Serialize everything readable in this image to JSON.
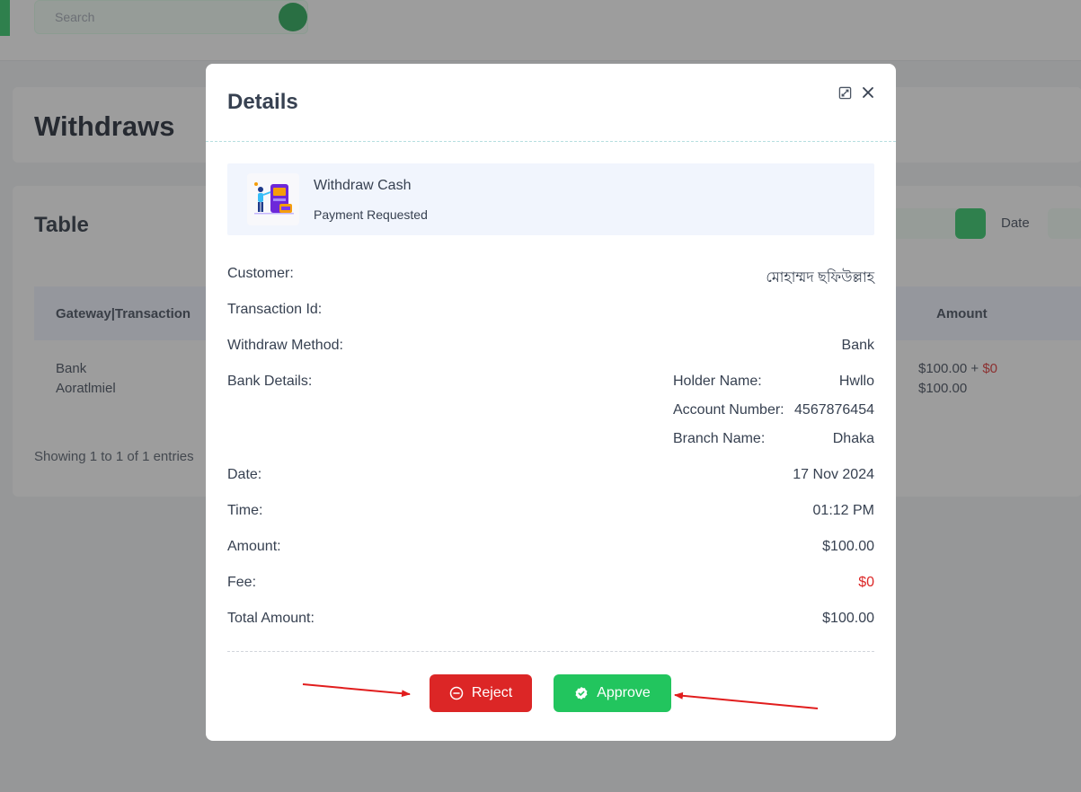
{
  "background": {
    "search_placeholder": "Search",
    "page_title": "Withdraws",
    "table_title": "Table",
    "date_label": "Date",
    "column_headers": [
      "Gateway|Transaction",
      "Amount"
    ],
    "row": {
      "gateway": "Bank",
      "transaction": "Aoratlmiel",
      "amount": "$100.00",
      "fee": "$0",
      "total": "$100.00"
    },
    "showing": "Showing 1 to 1 of 1 entries"
  },
  "modal": {
    "title": "Details",
    "summary": {
      "title": "Withdraw Cash",
      "subtitle": "Payment Requested"
    },
    "fields": {
      "customer_label": "Customer:",
      "customer_value": "মোহাম্মদ ছফিউল্লাহ",
      "transaction_label": "Transaction Id:",
      "transaction_value": "",
      "method_label": "Withdraw Method:",
      "method_value": "Bank",
      "bank_label": "Bank Details:",
      "holder_label": "Holder Name:",
      "holder_value": "Hwllo",
      "account_label": "Account Number:",
      "account_value": "4567876454",
      "branch_label": "Branch Name:",
      "branch_value": "Dhaka",
      "date_label": "Date:",
      "date_value": "17 Nov 2024",
      "time_label": "Time:",
      "time_value": "01:12 PM",
      "amount_label": "Amount:",
      "amount_value": "$100.00",
      "fee_label": "Fee:",
      "fee_value": "$0",
      "total_label": "Total Amount:",
      "total_value": "$100.00"
    },
    "buttons": {
      "reject": "Reject",
      "approve": "Approve"
    }
  },
  "colors": {
    "reject": "#dc2626",
    "approve": "#22c55e",
    "fee": "#dc2626",
    "annotation_arrow": "#e11d1d"
  },
  "icons": [
    "expand-icon",
    "close-icon",
    "withdraw-illustration-icon",
    "minus-circle-icon",
    "check-badge-icon"
  ]
}
